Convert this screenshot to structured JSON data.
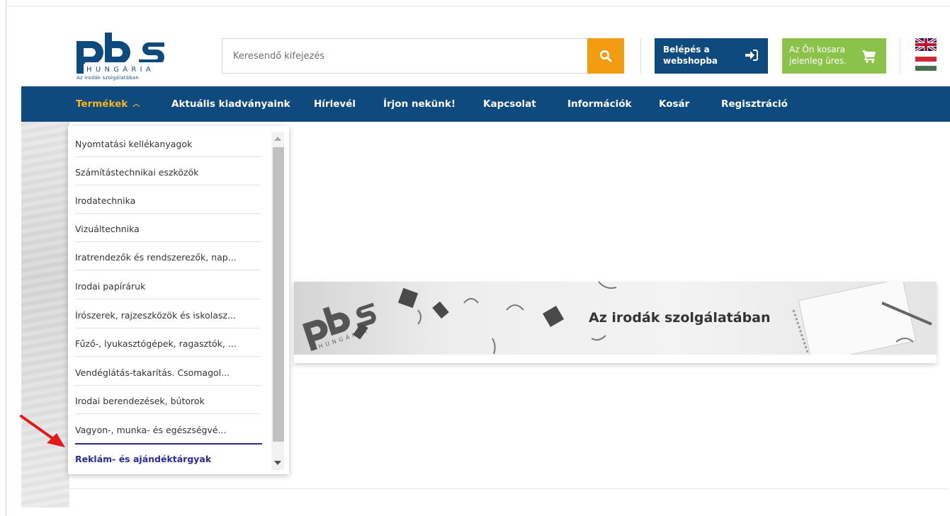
{
  "brand": {
    "tagline": "Az irodák szolgálatában",
    "logo_letters": "pbs",
    "logo_sub": "HUNGÁRIA"
  },
  "search": {
    "placeholder": "Keresendő kifejezés",
    "value": ""
  },
  "login": {
    "line1": "Belépés a",
    "line2": "webshopba"
  },
  "cart": {
    "line1": "Az Ön kosara",
    "line2": "jelenleg üres."
  },
  "nav": {
    "items": [
      {
        "label": "Termékek"
      },
      {
        "label": "Aktuális kiadványaink"
      },
      {
        "label": "Hírlevél"
      },
      {
        "label": "Írjon nekünk!"
      },
      {
        "label": "Kapcsolat"
      },
      {
        "label": "Információk"
      },
      {
        "label": "Kosár"
      },
      {
        "label": "Regisztráció"
      }
    ]
  },
  "menu": {
    "items": [
      {
        "label": "Nyomtatási kellékanyagok"
      },
      {
        "label": "Számítástechnikai eszközök"
      },
      {
        "label": "Irodatechnika"
      },
      {
        "label": "Vizuáltechnika"
      },
      {
        "label": "Iratrendezők és rendszerezők, nap..."
      },
      {
        "label": "Irodai papíráruk"
      },
      {
        "label": "Írószerek, rajzeszközök és iskolasz..."
      },
      {
        "label": "Fűző-, lyukasztógépek, ragasztók, ..."
      },
      {
        "label": "Vendéglátás-takarítás. Csomagol..."
      },
      {
        "label": "Irodai berendezések, bútorok"
      },
      {
        "label": "Vagyon-, munka- és egészségvé..."
      },
      {
        "label": "Reklám- és ajándéktárgyak"
      }
    ]
  },
  "banner": {
    "slogan": "Az irodák szolgálatában",
    "logo_sub": "HUNGÁRIA"
  },
  "colors": {
    "primary": "#0e4a7e",
    "accent_orange": "#f39c12",
    "cart_green": "#8bc34a",
    "nav_active": "#f6b51c",
    "menu_highlight": "#2a2aa0"
  }
}
